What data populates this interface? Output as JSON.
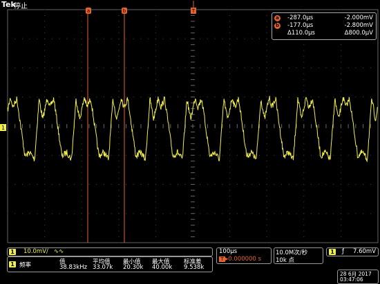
{
  "header": {
    "brand": "Tek",
    "run_state": "停止",
    "trigger_marker": "T"
  },
  "cursors": {
    "a_label": "a",
    "b_label": "b",
    "a_time": "-287.0µs",
    "a_value": "-2.000mV",
    "b_time": "-177.0µs",
    "b_value": "-2.800mV",
    "delta_time": "Δ110.0µs",
    "delta_value": "Δ800.0µV"
  },
  "channel": {
    "number": "1",
    "marker": "1",
    "scale": "10.0mV/",
    "coupling": "∿∿",
    "color": "#f4f04a"
  },
  "measurement": {
    "channel": "1",
    "name": "频率",
    "headers": [
      "值",
      "平均值",
      "最小值",
      "最大值",
      "标准差"
    ],
    "values": [
      "38.83kHz",
      "33.07k",
      "20.30k",
      "40.00k",
      "9.538k"
    ]
  },
  "timebase": {
    "scale": "100µs",
    "position": "▸0.000000 s",
    "sample_rate": "10.0M次/秒",
    "record_length": "10k 点"
  },
  "trigger": {
    "channel": "1",
    "slope": "ƒ",
    "level": "7.60mV"
  },
  "datetime": {
    "date": "28 6月 2017",
    "time": "03:47:06"
  },
  "colors": {
    "trace": "#f4f04a",
    "cursor": "#e8622c",
    "grid": "#555555"
  }
}
